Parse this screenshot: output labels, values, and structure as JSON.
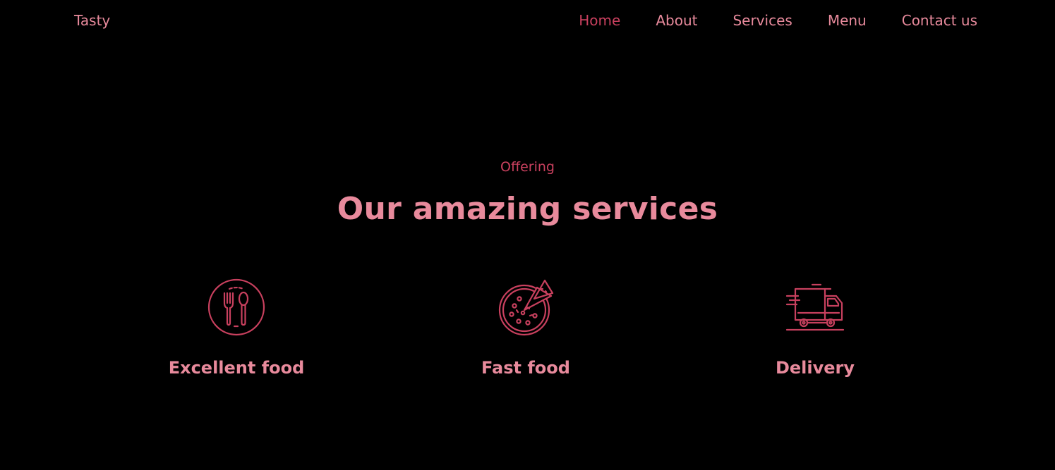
{
  "nav": {
    "brand": "Tasty",
    "links": [
      {
        "label": "Home",
        "active": true
      },
      {
        "label": "About",
        "active": false
      },
      {
        "label": "Services",
        "active": false
      },
      {
        "label": "Menu",
        "active": false
      },
      {
        "label": "Contact us",
        "active": false
      }
    ]
  },
  "services": {
    "eyebrow": "Offering",
    "heading": "Our amazing services",
    "items": [
      {
        "title": "Excellent food",
        "icon": "plate-cutlery-icon"
      },
      {
        "title": "Fast food",
        "icon": "pizza-icon"
      },
      {
        "title": "Delivery",
        "icon": "delivery-truck-icon"
      }
    ]
  },
  "colors": {
    "background": "#000000",
    "text_pink": "#e88a9c",
    "accent": "#c8405e"
  }
}
